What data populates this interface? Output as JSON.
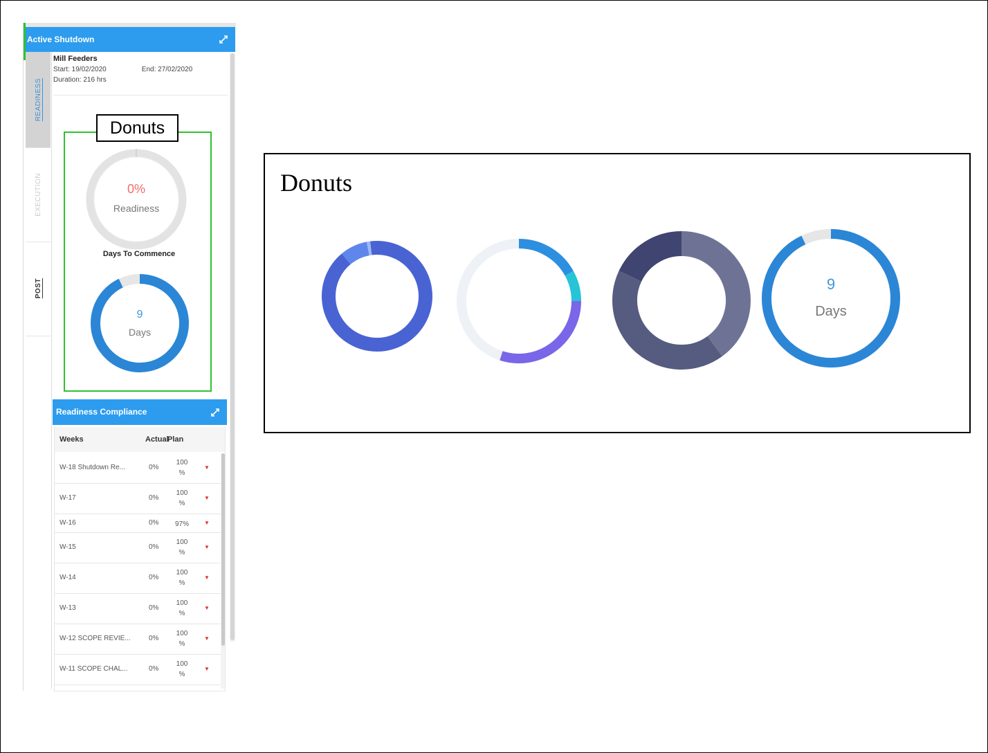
{
  "panel": {
    "header_title": "Active Shutdown",
    "tabs": [
      "READINESS",
      "EXECUTION",
      "POST"
    ],
    "shutdown": {
      "name": "Mill Feeders",
      "start": "Start: 19/02/2020",
      "end": "End: 27/02/2020",
      "duration": "Duration: 216 hrs"
    },
    "callout_label": "Donuts",
    "readiness_donut": {
      "value_text": "0%",
      "label": "Readiness",
      "value": 0
    },
    "days_title": "Days To Commence",
    "days_donut": {
      "value_text": "9",
      "label": "Days",
      "fraction": 0.93
    }
  },
  "compliance": {
    "title": "Readiness Compliance",
    "columns": [
      "Weeks",
      "Actual",
      "Plan"
    ],
    "rows": [
      {
        "week": "W-18 Shutdown Re...",
        "actual": "0%",
        "plan_line1": "100",
        "plan_line2": "%"
      },
      {
        "week": "W-17",
        "actual": "0%",
        "plan_line1": "100",
        "plan_line2": "%"
      },
      {
        "week": "W-16",
        "actual": "0%",
        "plan_line1": "97%",
        "plan_line2": ""
      },
      {
        "week": "W-15",
        "actual": "0%",
        "plan_line1": "100",
        "plan_line2": "%"
      },
      {
        "week": "W-14",
        "actual": "0%",
        "plan_line1": "100",
        "plan_line2": "%"
      },
      {
        "week": "W-13",
        "actual": "0%",
        "plan_line1": "100",
        "plan_line2": "%"
      },
      {
        "week": "W-12 SCOPE REVIE...",
        "actual": "0%",
        "plan_line1": "100",
        "plan_line2": "%"
      },
      {
        "week": "W-11 SCOPE CHAL...",
        "actual": "0%",
        "plan_line1": "100",
        "plan_line2": "%"
      }
    ],
    "arrow_glyph": "▼"
  },
  "donut_showcase": {
    "title": "Donuts",
    "donuts": [
      {
        "segments": [
          {
            "value": 0.89,
            "color": "#4a63d3"
          },
          {
            "value": 0.08,
            "color": "#5f86ea"
          },
          {
            "value": 0.01,
            "color": "#9fb8f5"
          },
          {
            "value": 0.02,
            "color": "#4a63d3"
          }
        ]
      },
      {
        "segments": [
          {
            "value": 0.17,
            "color": "#2d8fe0"
          },
          {
            "value": 0.08,
            "color": "#27c3d6"
          },
          {
            "value": 0.3,
            "color": "#7a66e8"
          },
          {
            "value": 0.45,
            "color": "#eef1f6"
          }
        ]
      },
      {
        "segments": [
          {
            "value": 0.4,
            "color": "#6e7396"
          },
          {
            "value": 0.42,
            "color": "#565b80"
          },
          {
            "value": 0.18,
            "color": "#3f4470"
          }
        ]
      },
      {
        "center_value": "9",
        "center_label": "Days",
        "segments": [
          {
            "value": 0.93,
            "color": "#2b86d6"
          },
          {
            "value": 0.07,
            "color": "#e6e6e6"
          }
        ]
      }
    ]
  },
  "colors": {
    "header_blue": "#2d9cee",
    "green_highlight": "#2fc12f",
    "readiness_red": "#f26b6b",
    "days_blue": "#2b86d6",
    "arrow_red": "#e0302f"
  }
}
